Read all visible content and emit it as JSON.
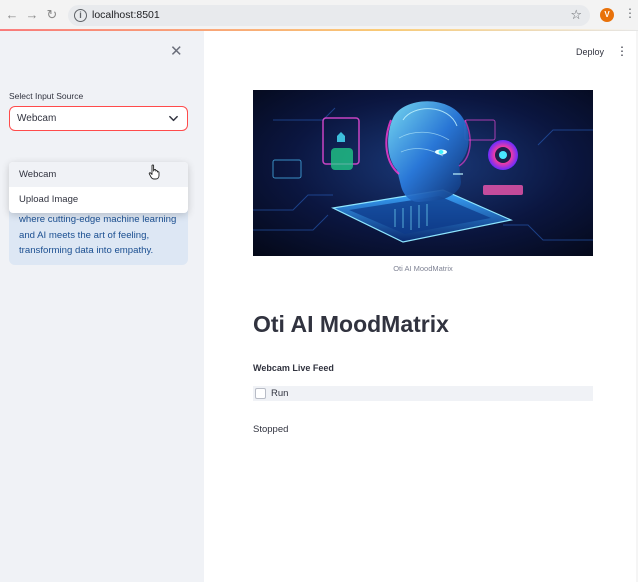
{
  "browser": {
    "url": "localhost:8501",
    "info_glyph": "i",
    "profile_initial": "V"
  },
  "toolbar": {
    "deploy_label": "Deploy"
  },
  "sidebar": {
    "select_label": "Select Input Source",
    "selected_value": "Webcam",
    "options": [
      "Webcam",
      "Upload Image"
    ],
    "info_text": "Unlocking the future of emotional intelligence with Oti AI Mood Matrix where cutting-edge machine learning and AI meets the art of feeling, transforming data into empathy."
  },
  "main": {
    "image_caption": "Oti AI MoodMatrix",
    "title": "Oti AI MoodMatrix",
    "feed_header": "Webcam Live Feed",
    "run_label": "Run",
    "run_checked": false,
    "status_text": "Stopped"
  },
  "colors": {
    "accent": "#ff4b4b",
    "sidebar_bg": "#f0f2f6",
    "info_bg": "#dde7f4",
    "info_text": "#1b4f91"
  }
}
